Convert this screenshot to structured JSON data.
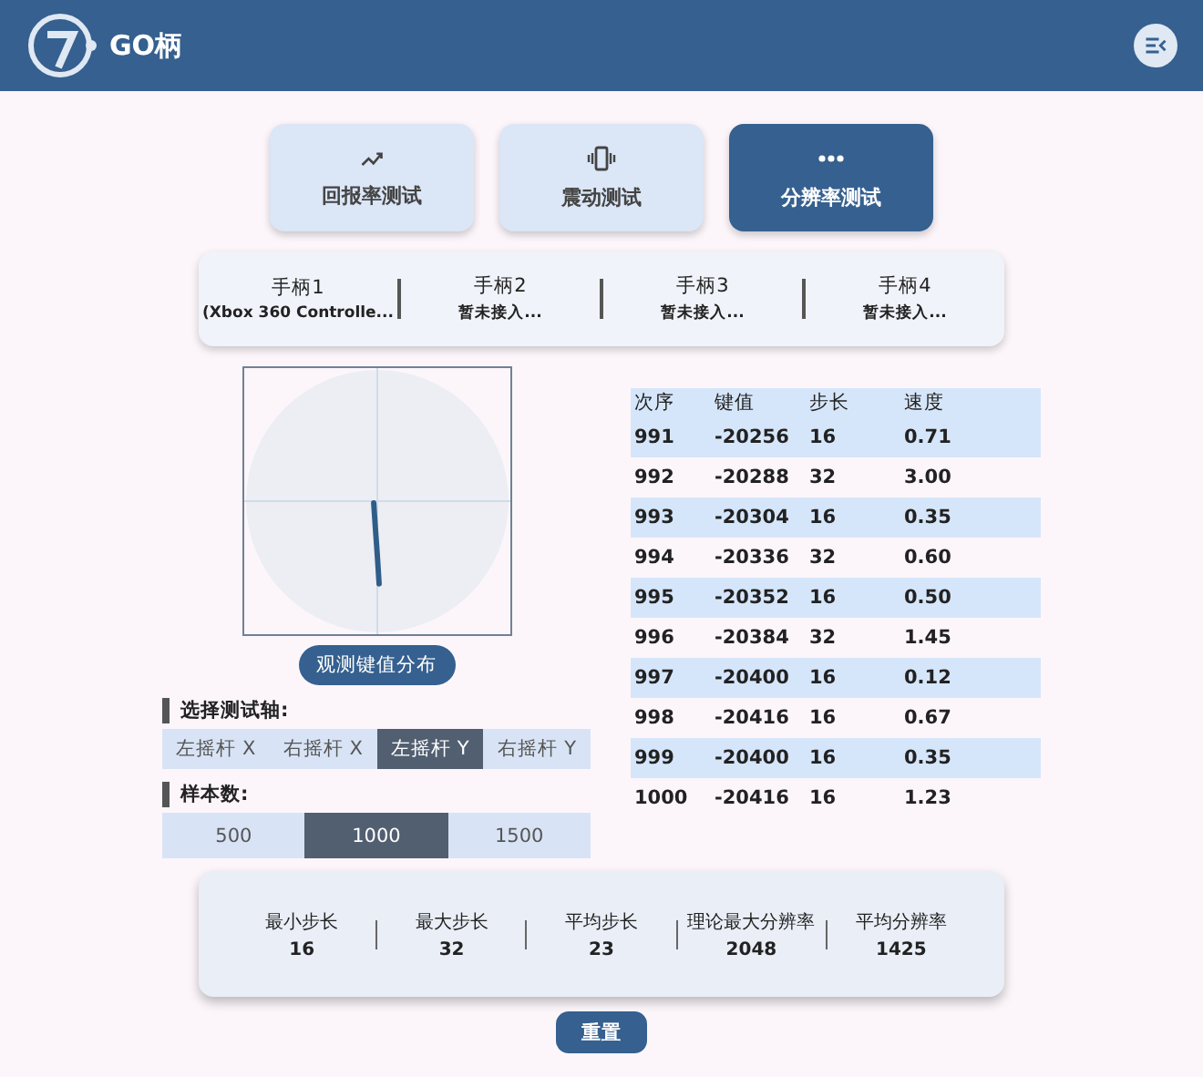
{
  "app": {
    "title": "GO柄"
  },
  "tabs": [
    {
      "label": "回报率测试",
      "kind": "trend",
      "selected": false
    },
    {
      "label": "震动测试",
      "kind": "vibrate",
      "selected": false
    },
    {
      "label": "分辨率测试",
      "kind": "dots",
      "selected": true
    }
  ],
  "controllers": [
    {
      "name": "手柄1",
      "status": "(Xbox 360 Controlle..."
    },
    {
      "name": "手柄2",
      "status": "暂未接入..."
    },
    {
      "name": "手柄3",
      "status": "暂未接入..."
    },
    {
      "name": "手柄4",
      "status": "暂未接入..."
    }
  ],
  "observe_button": "观测键值分布",
  "axis_select": {
    "label": "选择测试轴:",
    "options": [
      {
        "label": "左摇杆 X",
        "selected": false
      },
      {
        "label": "右摇杆 X",
        "selected": false
      },
      {
        "label": "左摇杆 Y",
        "selected": true
      },
      {
        "label": "右摇杆 Y",
        "selected": false
      }
    ]
  },
  "samples": {
    "label": "样本数:",
    "options": [
      {
        "label": "500",
        "selected": false
      },
      {
        "label": "1000",
        "selected": true
      },
      {
        "label": "1500",
        "selected": false
      }
    ]
  },
  "table": {
    "columns": [
      "次序",
      "键值",
      "步长",
      "速度"
    ],
    "rows": [
      [
        "991",
        "-20256",
        "16",
        "0.71"
      ],
      [
        "992",
        "-20288",
        "32",
        "3.00"
      ],
      [
        "993",
        "-20304",
        "16",
        "0.35"
      ],
      [
        "994",
        "-20336",
        "32",
        "0.60"
      ],
      [
        "995",
        "-20352",
        "16",
        "0.50"
      ],
      [
        "996",
        "-20384",
        "32",
        "1.45"
      ],
      [
        "997",
        "-20400",
        "16",
        "0.12"
      ],
      [
        "998",
        "-20416",
        "16",
        "0.67"
      ],
      [
        "999",
        "-20400",
        "16",
        "0.35"
      ],
      [
        "1000",
        "-20416",
        "16",
        "1.23"
      ]
    ]
  },
  "stats": [
    {
      "label": "最小步长",
      "value": "16"
    },
    {
      "label": "最大步长",
      "value": "32"
    },
    {
      "label": "平均步长",
      "value": "23"
    },
    {
      "label": "理论最大分辨率",
      "value": "2048"
    },
    {
      "label": "平均分辨率",
      "value": "1425"
    }
  ],
  "reset_button": "重置"
}
